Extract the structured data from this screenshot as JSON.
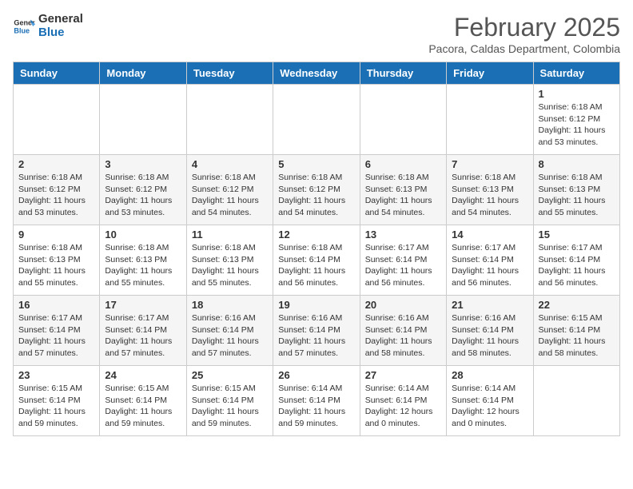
{
  "header": {
    "logo_line1": "General",
    "logo_line2": "Blue",
    "month_year": "February 2025",
    "location": "Pacora, Caldas Department, Colombia"
  },
  "days_of_week": [
    "Sunday",
    "Monday",
    "Tuesday",
    "Wednesday",
    "Thursday",
    "Friday",
    "Saturday"
  ],
  "weeks": [
    [
      {
        "day": "",
        "info": ""
      },
      {
        "day": "",
        "info": ""
      },
      {
        "day": "",
        "info": ""
      },
      {
        "day": "",
        "info": ""
      },
      {
        "day": "",
        "info": ""
      },
      {
        "day": "",
        "info": ""
      },
      {
        "day": "1",
        "info": "Sunrise: 6:18 AM\nSunset: 6:12 PM\nDaylight: 11 hours\nand 53 minutes."
      }
    ],
    [
      {
        "day": "2",
        "info": "Sunrise: 6:18 AM\nSunset: 6:12 PM\nDaylight: 11 hours\nand 53 minutes."
      },
      {
        "day": "3",
        "info": "Sunrise: 6:18 AM\nSunset: 6:12 PM\nDaylight: 11 hours\nand 53 minutes."
      },
      {
        "day": "4",
        "info": "Sunrise: 6:18 AM\nSunset: 6:12 PM\nDaylight: 11 hours\nand 54 minutes."
      },
      {
        "day": "5",
        "info": "Sunrise: 6:18 AM\nSunset: 6:12 PM\nDaylight: 11 hours\nand 54 minutes."
      },
      {
        "day": "6",
        "info": "Sunrise: 6:18 AM\nSunset: 6:13 PM\nDaylight: 11 hours\nand 54 minutes."
      },
      {
        "day": "7",
        "info": "Sunrise: 6:18 AM\nSunset: 6:13 PM\nDaylight: 11 hours\nand 54 minutes."
      },
      {
        "day": "8",
        "info": "Sunrise: 6:18 AM\nSunset: 6:13 PM\nDaylight: 11 hours\nand 55 minutes."
      }
    ],
    [
      {
        "day": "9",
        "info": "Sunrise: 6:18 AM\nSunset: 6:13 PM\nDaylight: 11 hours\nand 55 minutes."
      },
      {
        "day": "10",
        "info": "Sunrise: 6:18 AM\nSunset: 6:13 PM\nDaylight: 11 hours\nand 55 minutes."
      },
      {
        "day": "11",
        "info": "Sunrise: 6:18 AM\nSunset: 6:13 PM\nDaylight: 11 hours\nand 55 minutes."
      },
      {
        "day": "12",
        "info": "Sunrise: 6:18 AM\nSunset: 6:14 PM\nDaylight: 11 hours\nand 56 minutes."
      },
      {
        "day": "13",
        "info": "Sunrise: 6:17 AM\nSunset: 6:14 PM\nDaylight: 11 hours\nand 56 minutes."
      },
      {
        "day": "14",
        "info": "Sunrise: 6:17 AM\nSunset: 6:14 PM\nDaylight: 11 hours\nand 56 minutes."
      },
      {
        "day": "15",
        "info": "Sunrise: 6:17 AM\nSunset: 6:14 PM\nDaylight: 11 hours\nand 56 minutes."
      }
    ],
    [
      {
        "day": "16",
        "info": "Sunrise: 6:17 AM\nSunset: 6:14 PM\nDaylight: 11 hours\nand 57 minutes."
      },
      {
        "day": "17",
        "info": "Sunrise: 6:17 AM\nSunset: 6:14 PM\nDaylight: 11 hours\nand 57 minutes."
      },
      {
        "day": "18",
        "info": "Sunrise: 6:16 AM\nSunset: 6:14 PM\nDaylight: 11 hours\nand 57 minutes."
      },
      {
        "day": "19",
        "info": "Sunrise: 6:16 AM\nSunset: 6:14 PM\nDaylight: 11 hours\nand 57 minutes."
      },
      {
        "day": "20",
        "info": "Sunrise: 6:16 AM\nSunset: 6:14 PM\nDaylight: 11 hours\nand 58 minutes."
      },
      {
        "day": "21",
        "info": "Sunrise: 6:16 AM\nSunset: 6:14 PM\nDaylight: 11 hours\nand 58 minutes."
      },
      {
        "day": "22",
        "info": "Sunrise: 6:15 AM\nSunset: 6:14 PM\nDaylight: 11 hours\nand 58 minutes."
      }
    ],
    [
      {
        "day": "23",
        "info": "Sunrise: 6:15 AM\nSunset: 6:14 PM\nDaylight: 11 hours\nand 59 minutes."
      },
      {
        "day": "24",
        "info": "Sunrise: 6:15 AM\nSunset: 6:14 PM\nDaylight: 11 hours\nand 59 minutes."
      },
      {
        "day": "25",
        "info": "Sunrise: 6:15 AM\nSunset: 6:14 PM\nDaylight: 11 hours\nand 59 minutes."
      },
      {
        "day": "26",
        "info": "Sunrise: 6:14 AM\nSunset: 6:14 PM\nDaylight: 11 hours\nand 59 minutes."
      },
      {
        "day": "27",
        "info": "Sunrise: 6:14 AM\nSunset: 6:14 PM\nDaylight: 12 hours\nand 0 minutes."
      },
      {
        "day": "28",
        "info": "Sunrise: 6:14 AM\nSunset: 6:14 PM\nDaylight: 12 hours\nand 0 minutes."
      },
      {
        "day": "",
        "info": ""
      }
    ]
  ]
}
